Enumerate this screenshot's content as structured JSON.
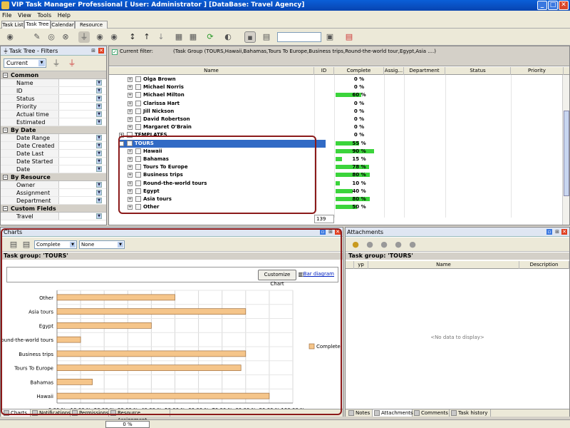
{
  "window": {
    "title": "VIP Task Manager Professional [ User: Administrator ] [DataBase: Travel Agency]"
  },
  "menu": [
    "File",
    "View",
    "Tools",
    "Help"
  ],
  "tabs": [
    "Task List",
    "Task Tree",
    "Calendar",
    "Resource List"
  ],
  "filters": {
    "panel_title": "Task Tree - Filters",
    "current_value": "Current",
    "sections": [
      {
        "title": "Common",
        "items": [
          "Name",
          "ID",
          "Status",
          "Priority",
          "Actual time",
          "Estimated Time"
        ]
      },
      {
        "title": "By Date",
        "items": [
          "Date Range",
          "Date Created",
          "Date Last Modified",
          "Date Started",
          "Date Completed"
        ]
      },
      {
        "title": "By Resource",
        "items": [
          "Owner",
          "Assignment",
          "Department"
        ]
      },
      {
        "title": "Custom Fields",
        "items": [
          "Travel"
        ]
      }
    ]
  },
  "grid": {
    "current_filter_label": "Current filter:",
    "current_filter_value": "(Task Group  (TOURS,Hawaii,Bahamas,Tours To Europe,Business trips,Round-the-world tour,Egypt,Asia ....)",
    "columns": [
      "Name",
      "ID",
      "Complete",
      "Assig...",
      "Department",
      "Status",
      "Priority"
    ],
    "rows": [
      {
        "name": "Olga Brown",
        "complete": "0 %",
        "pct": 0,
        "level": 1
      },
      {
        "name": "Michael Norris",
        "complete": "0 %",
        "pct": 0,
        "level": 1
      },
      {
        "name": "Michael Milton",
        "complete": "60 %",
        "pct": 60,
        "level": 1
      },
      {
        "name": "Clarissa Hart",
        "complete": "0 %",
        "pct": 0,
        "level": 1
      },
      {
        "name": "Jill Nickson",
        "complete": "0 %",
        "pct": 0,
        "level": 1
      },
      {
        "name": "David Robertson",
        "complete": "0 %",
        "pct": 0,
        "level": 1
      },
      {
        "name": "Margaret O'Brain",
        "complete": "0 %",
        "pct": 0,
        "level": 1
      },
      {
        "name": "TEMPLATES",
        "complete": "0 %",
        "pct": 0,
        "level": 0
      },
      {
        "name": "TOURS",
        "complete": "55 %",
        "pct": 55,
        "level": 0,
        "selected": true
      },
      {
        "name": "Hawaii",
        "complete": "90 %",
        "pct": 90,
        "level": 1
      },
      {
        "name": "Bahamas",
        "complete": "15 %",
        "pct": 15,
        "level": 1
      },
      {
        "name": "Tours To Europe",
        "complete": "78 %",
        "pct": 78,
        "level": 1
      },
      {
        "name": "Business trips",
        "complete": "80 %",
        "pct": 80,
        "level": 1
      },
      {
        "name": "Round-the-world tours",
        "complete": "10 %",
        "pct": 10,
        "level": 1
      },
      {
        "name": "Egypt",
        "complete": "40 %",
        "pct": 40,
        "level": 1
      },
      {
        "name": "Asia tours",
        "complete": "80 %",
        "pct": 80,
        "level": 1
      },
      {
        "name": "Other",
        "complete": "50 %",
        "pct": 50,
        "level": 1
      }
    ],
    "footer_id": "139"
  },
  "charts": {
    "panel_title": "Charts",
    "field_select": "Complete",
    "group_select": "None",
    "task_group_label": "Task group: 'TOURS'",
    "customize_label": "Customize Chart",
    "bar_diagram_label": "Bar diagram",
    "bottom_tabs": [
      "Charts",
      "Notifications",
      "Permissions",
      "Resource Assignment"
    ]
  },
  "chart_data": {
    "type": "bar",
    "orientation": "horizontal",
    "categories": [
      "Other",
      "Asia tours",
      "Egypt",
      "Round-the-world tours",
      "Business trips",
      "Tours To Europe",
      "Bahamas",
      "Hawaii"
    ],
    "series": [
      {
        "name": "Complete",
        "values": [
          50,
          80,
          40,
          10,
          80,
          78,
          15,
          90
        ]
      }
    ],
    "xticks": [
      "0.00 %",
      "10.00 %",
      "20.00 %",
      "30.00 %",
      "40.00 %",
      "50.00 %",
      "60.00 %",
      "70.00 %",
      "80.00 %",
      "90.00 %",
      "100.00 %"
    ],
    "xlim": [
      0,
      100
    ],
    "grid": true,
    "legend": "right",
    "bar_color": "#f5c58a"
  },
  "attachments": {
    "panel_title": "Attachments",
    "task_group_label": "Task group: 'TOURS'",
    "columns": [
      "yp",
      "Name",
      "Description"
    ],
    "empty_text": "<No data to display>",
    "bottom_tabs": [
      "Notes",
      "Attachments",
      "Comments",
      "Task history"
    ]
  },
  "status": {
    "progress": "0 %"
  }
}
